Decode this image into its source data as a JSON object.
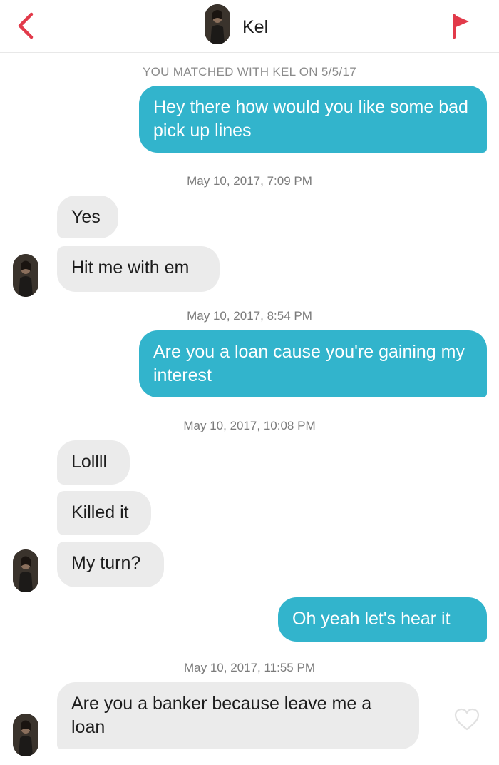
{
  "header": {
    "contact_name": "Kel",
    "accent_color": "#e23a4a"
  },
  "match_notice": "YOU MATCHED WITH KEL ON 5/5/17",
  "timestamps": [
    "May 10, 2017, 7:09 PM",
    "May 10, 2017, 8:54 PM",
    "May 10, 2017, 10:08 PM",
    "May 10, 2017, 11:55 PM"
  ],
  "messages": [
    {
      "from": "me",
      "text": "Hey there how would you like some bad pick up lines"
    },
    {
      "from": "them",
      "text": "Yes"
    },
    {
      "from": "them",
      "text": "Hit me with em"
    },
    {
      "from": "me",
      "text": "Are you a loan cause you're gaining my interest"
    },
    {
      "from": "them",
      "text": "Lollll"
    },
    {
      "from": "them",
      "text": "Killed it"
    },
    {
      "from": "them",
      "text": "My turn?"
    },
    {
      "from": "me",
      "text": "Oh yeah let's hear it"
    },
    {
      "from": "them",
      "text": "Are you a banker because leave me a loan"
    }
  ],
  "colors": {
    "outgoing_bubble": "#32b4cc",
    "incoming_bubble": "#ebebeb"
  },
  "icons": {
    "back": "chevron-left-icon",
    "report": "flag-icon",
    "like": "heart-outline-icon"
  }
}
